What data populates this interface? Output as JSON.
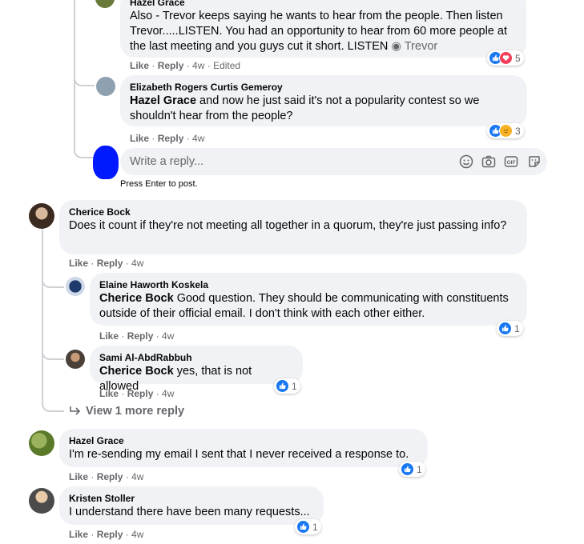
{
  "comments": [
    {
      "author": "Hazel Grace",
      "text": "Also - Trevor keeps saying he wants to hear from the people. Then listen Trevor.....LISTEN. You had an opportunity to hear from 60 more people at the last meeting and you guys cut it short. LISTEN",
      "link": "Trevor",
      "actions": {
        "like": "Like",
        "reply": "Reply",
        "time": "4w",
        "edited": "Edited"
      },
      "reactions": "5"
    },
    {
      "author": "Elizabeth Rogers Curtis Gemeroy",
      "mention": "Hazel Grace",
      "text": " and now he just said it's not a popularity contest so we shouldn't hear from the people?",
      "actions": {
        "like": "Like",
        "reply": "Reply",
        "time": "4w"
      },
      "reactions": "3"
    },
    {
      "author": "Cherice Bock",
      "text": "Does it count if they're not meeting all together in a quorum, they're just passing info?",
      "actions": {
        "like": "Like",
        "reply": "Reply",
        "time": "4w"
      }
    },
    {
      "author": "Elaine Haworth Koskela",
      "mention": "Cherice Bock",
      "text": " Good question. They should be communicating with constituents outside of their official email. I don't think with each other either.",
      "actions": {
        "like": "Like",
        "reply": "Reply",
        "time": "4w"
      },
      "reactions": "1"
    },
    {
      "author": "Sami Al-AbdRabbuh",
      "mention": "Cherice Bock",
      "text": " yes, that is not allowed",
      "actions": {
        "like": "Like",
        "reply": "Reply",
        "time": "4w"
      },
      "reactions": "1"
    },
    {
      "author": "Hazel Grace",
      "text": "I'm re-sending my email I sent that I never received a response to.",
      "actions": {
        "like": "Like",
        "reply": "Reply",
        "time": "4w"
      },
      "reactions": "1"
    },
    {
      "author": "Kristen Stoller",
      "text": "I understand there have been many requests...",
      "actions": {
        "like": "Like",
        "reply": "Reply",
        "time": "4w"
      },
      "reactions": "1"
    }
  ],
  "reply_box": {
    "placeholder": "Write a reply...",
    "hint": "Press Enter to post.",
    "icons": [
      "emoji-icon",
      "camera-icon",
      "gif-icon",
      "sticker-icon"
    ]
  },
  "view_more": "View 1 more reply",
  "colors": {
    "like": "#1877f2",
    "love": "#f33e58",
    "sad": "#f7b125",
    "bubble": "#f0f2f5",
    "meta": "#65676b"
  }
}
